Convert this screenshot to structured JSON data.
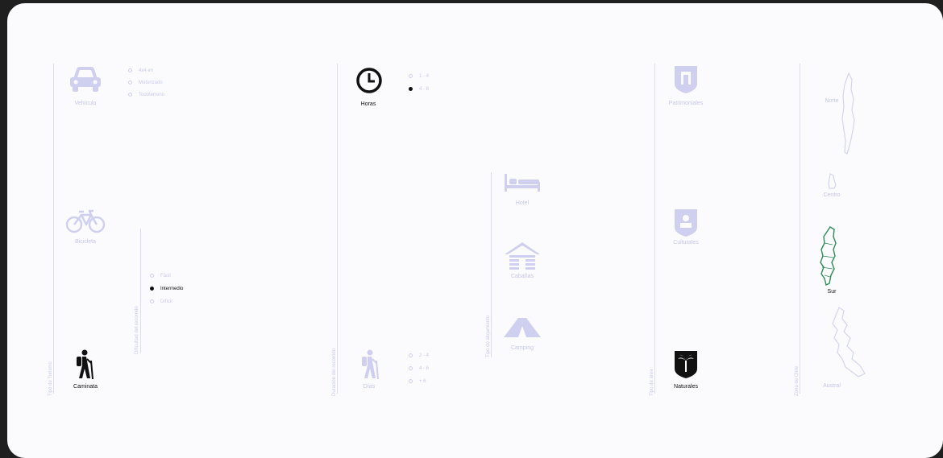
{
  "colors": {
    "inactive": "#c5c5ea",
    "active": "#111111",
    "south_region": "#2e8b57"
  },
  "sections": {
    "transport": {
      "axis_label": "Tipo de Turismo",
      "items": [
        {
          "label": "Vehículo",
          "icon": "car-icon",
          "active": false
        },
        {
          "label": "Bicicleta",
          "icon": "bicycle-icon",
          "active": false
        },
        {
          "label": "Caminata",
          "icon": "hiker-icon",
          "active": true
        }
      ],
      "vehicle_options": [
        {
          "label": "4x4 en",
          "active": false
        },
        {
          "label": "Motorizado",
          "active": false
        },
        {
          "label": "Todoterreno",
          "active": false
        }
      ]
    },
    "difficulty": {
      "axis_label": "Dificultad del recorrido",
      "options": [
        {
          "label": "Fácil",
          "active": false
        },
        {
          "label": "Intermedio",
          "active": true
        },
        {
          "label": "Difícil",
          "active": false
        }
      ]
    },
    "duration": {
      "axis_label": "Duración del recorrido",
      "hours": {
        "label": "Horas",
        "icon": "clock-icon",
        "active": true,
        "options": [
          {
            "label": "1 - 4",
            "active": false
          },
          {
            "label": "4 - 8",
            "active": true
          }
        ]
      },
      "days": {
        "label": "Días",
        "icon": "hiker-icon",
        "active": false,
        "options": [
          {
            "label": "2 - 4",
            "active": false
          },
          {
            "label": "4 - 6",
            "active": false
          },
          {
            "label": "+ 6",
            "active": false
          }
        ]
      }
    },
    "lodging": {
      "axis_label": "Tipo de alojamiento",
      "items": [
        {
          "label": "Hotel",
          "icon": "bed-icon",
          "active": false
        },
        {
          "label": "Cabañas",
          "icon": "cabin-icon",
          "active": false
        },
        {
          "label": "Camping",
          "icon": "tent-icon",
          "active": false
        }
      ]
    },
    "reserve": {
      "axis_label": "Tipo de área",
      "items": [
        {
          "label": "Patrimoniales",
          "icon": "shield-building-icon",
          "active": false
        },
        {
          "label": "Culturales",
          "icon": "shield-culture-icon",
          "active": false
        },
        {
          "label": "Naturales",
          "icon": "shield-palm-icon",
          "active": true
        }
      ]
    },
    "zone": {
      "axis_label": "Zona de Chile",
      "items": [
        {
          "label": "Norte",
          "icon": "map-north-icon",
          "active": false
        },
        {
          "label": "Centro",
          "icon": "map-center-icon",
          "active": false
        },
        {
          "label": "Sur",
          "icon": "map-south-icon",
          "active": true
        },
        {
          "label": "Austral",
          "icon": "map-austral-icon",
          "active": false
        }
      ]
    }
  }
}
